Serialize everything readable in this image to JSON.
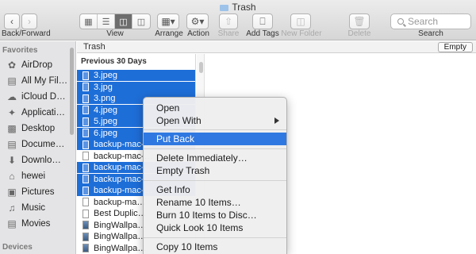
{
  "window": {
    "title": "Trash"
  },
  "toolbar": {
    "nav_label": "Back/Forward",
    "back_icon": "chevron-left-icon",
    "forward_icon": "chevron-right-icon",
    "view_label": "View",
    "view_modes": [
      "icon-view",
      "list-view",
      "column-view",
      "cover-flow-view"
    ],
    "active_view": "column-view",
    "arrange_label": "Arrange",
    "action_label": "Action",
    "share_label": "Share",
    "addtags_label": "Add Tags",
    "newfolder_label": "New Folder",
    "delete_label": "Delete",
    "search_label": "Search",
    "search_placeholder": "Search"
  },
  "sidebar": {
    "favorites_header": "Favorites",
    "devices_header": "Devices",
    "items": [
      {
        "label": "AirDrop",
        "icon": "airdrop-icon"
      },
      {
        "label": "All My Fil…",
        "icon": "all-files-icon"
      },
      {
        "label": "iCloud D…",
        "icon": "cloud-icon"
      },
      {
        "label": "Applicati…",
        "icon": "applications-icon"
      },
      {
        "label": "Desktop",
        "icon": "desktop-icon"
      },
      {
        "label": "Docume…",
        "icon": "documents-icon"
      },
      {
        "label": "Downlo…",
        "icon": "downloads-icon"
      },
      {
        "label": "hewei",
        "icon": "home-icon"
      },
      {
        "label": "Pictures",
        "icon": "pictures-icon"
      },
      {
        "label": "Music",
        "icon": "music-icon"
      },
      {
        "label": "Movies",
        "icon": "movies-icon"
      }
    ]
  },
  "pathbar": {
    "crumb": "Trash",
    "empty_button": "Empty"
  },
  "column": {
    "header": "Previous 30 Days",
    "files": [
      {
        "name": "3.jpeg",
        "selected": true
      },
      {
        "name": "3.jpg",
        "selected": true
      },
      {
        "name": "3.png",
        "selected": true
      },
      {
        "name": "4.jpeg",
        "selected": true
      },
      {
        "name": "5.jpeg",
        "selected": true
      },
      {
        "name": "6.jpeg",
        "selected": true
      },
      {
        "name": "backup-mac-…",
        "selected": true
      },
      {
        "name": "backup-mac-…",
        "selected": false
      },
      {
        "name": "backup-mac-…",
        "selected": true
      },
      {
        "name": "backup-mac-…",
        "selected": true
      },
      {
        "name": "backup-mac-…",
        "selected": true
      },
      {
        "name": "backup-ma…",
        "selected": false
      },
      {
        "name": "Best Duplic…",
        "selected": false
      },
      {
        "name": "BingWallpa…",
        "selected": false
      },
      {
        "name": "BingWallpa…",
        "selected": false
      },
      {
        "name": "BingWallpa…",
        "selected": false
      }
    ]
  },
  "context_menu": {
    "items": [
      {
        "label": "Open"
      },
      {
        "label": "Open With",
        "submenu": true
      },
      {
        "label": "Put Back",
        "highlighted": true
      },
      {
        "label": "Delete Immediately…"
      },
      {
        "label": "Empty Trash"
      },
      {
        "label": "Get Info"
      },
      {
        "label": "Rename 10 Items…"
      },
      {
        "label": "Burn 10 Items to Disc…"
      },
      {
        "label": "Quick Look 10 Items"
      },
      {
        "label": "Copy 10 Items"
      }
    ]
  },
  "colors": {
    "selection": "#1e6ed8",
    "menu_highlight": "#2f78e1"
  }
}
